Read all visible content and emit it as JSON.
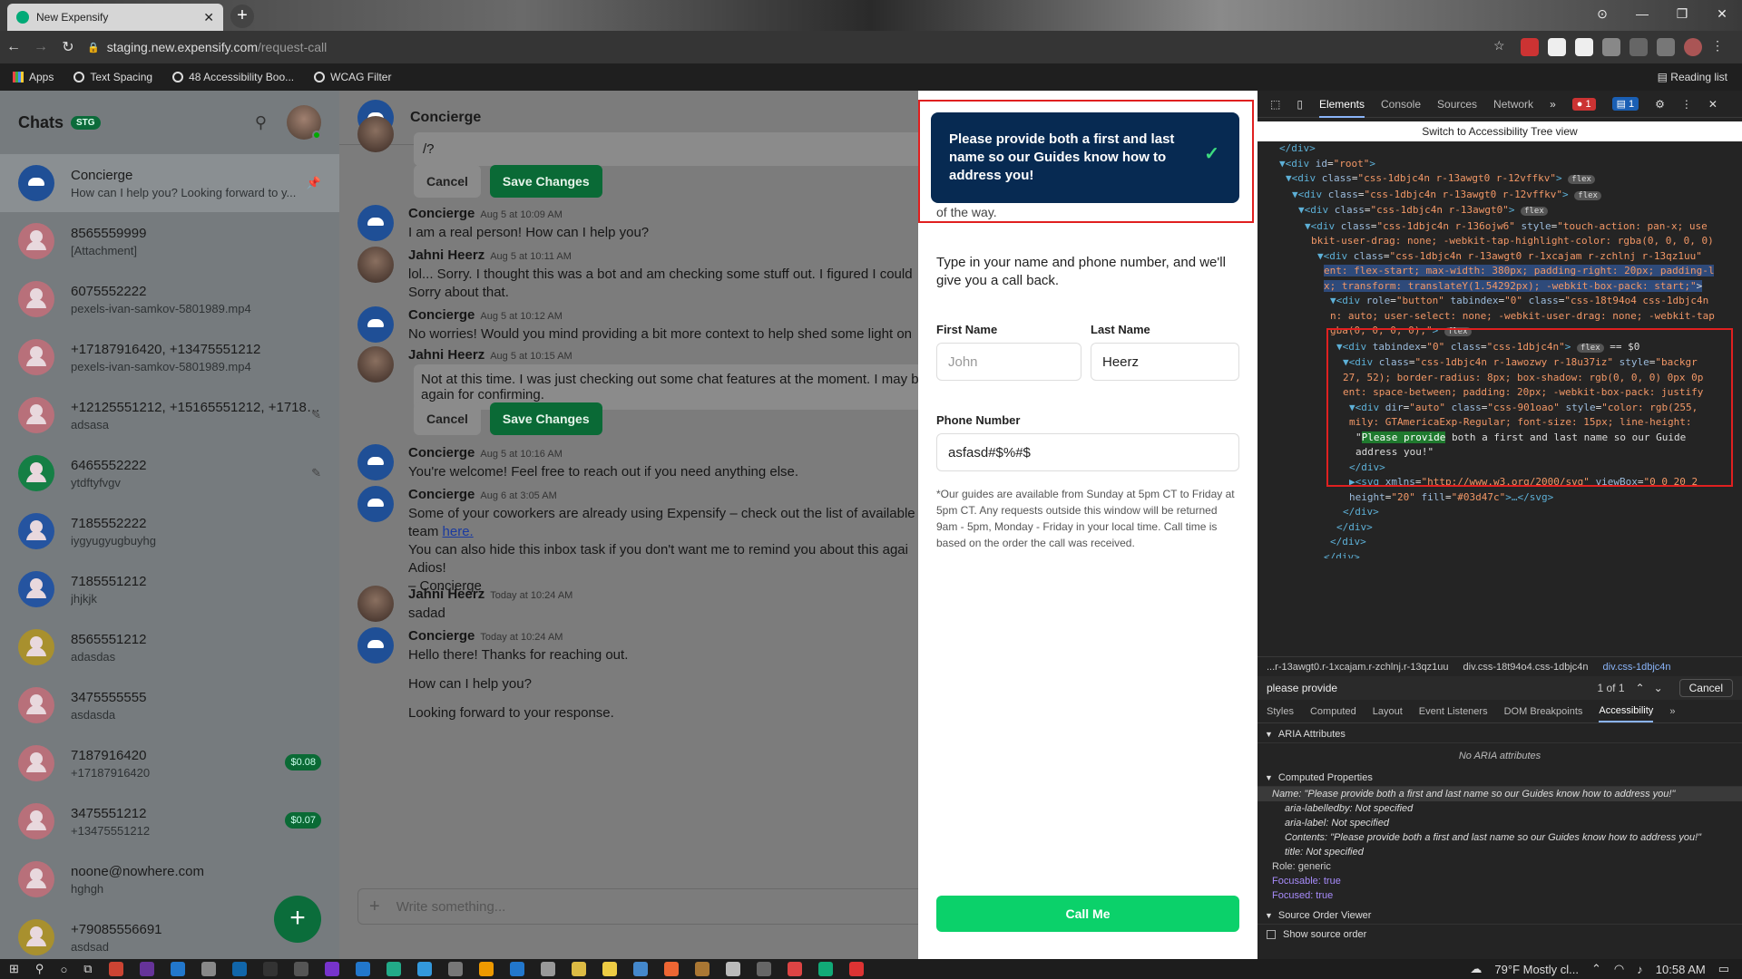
{
  "browser": {
    "tab_title": "New Expensify",
    "url_host": "staging.new.expensify.com",
    "url_path": "/request-call",
    "bookmarks": [
      "Apps",
      "Text Spacing",
      "48 Accessibility Boo...",
      "WCAG Filter"
    ],
    "reading_list": "Reading list"
  },
  "sidebar": {
    "title": "Chats",
    "badge": "STG",
    "chats": [
      {
        "name": "Concierge",
        "sub": "How can I help you? Looking forward to y...",
        "avatar": "concierge"
      },
      {
        "name": "8565559999",
        "sub": "[Attachment]",
        "avatar": "pink"
      },
      {
        "name": "6075552222",
        "sub": "pexels-ivan-samkov-5801989.mp4",
        "avatar": "pink"
      },
      {
        "name": "+17187916420, +13475551212",
        "sub": "pexels-ivan-samkov-5801989.mp4",
        "avatar": "pink"
      },
      {
        "name": "+12125551212, +15165551212, +17187...",
        "sub": "adsasa",
        "avatar": "pink"
      },
      {
        "name": "6465552222",
        "sub": "ytdftyfvgv",
        "avatar": "green"
      },
      {
        "name": "7185552222",
        "sub": "iygyugyugbuyhg",
        "avatar": "blue"
      },
      {
        "name": "7185551212",
        "sub": "jhjkjk",
        "avatar": "blue"
      },
      {
        "name": "8565551212",
        "sub": "adasdas",
        "avatar": "yellow"
      },
      {
        "name": "3475555555",
        "sub": "asdasda",
        "avatar": "pink"
      },
      {
        "name": "7187916420",
        "sub": "+17187916420",
        "avatar": "pink",
        "pill": "$0.08"
      },
      {
        "name": "3475551212",
        "sub": "+13475551212",
        "avatar": "pink",
        "pill": "$0.07"
      },
      {
        "name": "noone@nowhere.com",
        "sub": "hghgh",
        "avatar": "pink"
      },
      {
        "name": "+79085556691",
        "sub": "asdsad",
        "avatar": "yellow"
      }
    ]
  },
  "main": {
    "title": "Concierge",
    "edit1_text": "/?",
    "cancel": "Cancel",
    "save": "Save Changes",
    "messages": [
      {
        "who": "Concierge",
        "ts": "Aug 5 at 10:09 AM",
        "text": "I am a real person! How can I help you?"
      },
      {
        "who": "Jahni Heerz",
        "ts": "Aug 5 at 10:11 AM",
        "text": "lol... Sorry. I thought this was a bot and am checking some stuff out. I figured I could",
        "text2": "Sorry about that."
      },
      {
        "who": "Concierge",
        "ts": "Aug 5 at 10:12 AM",
        "text": "No worries! Would you mind providing a bit more context to help shed some light on"
      },
      {
        "who": "Jahni Heerz",
        "ts": "Aug 5 at 10:15 AM",
        "text": "Not at this time. I was just checking out some chat features at the moment. I may b",
        "text2": "again for confirming."
      },
      {
        "who": "Concierge",
        "ts": "Aug 5 at 10:16 AM",
        "text": "You're welcome! Feel free to reach out if you need anything else."
      },
      {
        "who": "Concierge",
        "ts": "Aug 6 at 3:05 AM",
        "text": "Some of your coworkers are already using Expensify – check out the list of available",
        "text2a": "team ",
        "link": "here.",
        "text3": "You can also hide this inbox task if you don't want me to remind you about this agai",
        "text4": "Adios!",
        "text5": "– Concierge"
      },
      {
        "who": "Jahni Heerz",
        "ts": "Today at 10:24 AM",
        "text": "sadad"
      },
      {
        "who": "Concierge",
        "ts": "Today at 10:24 AM",
        "text": "Hello there! Thanks for reaching out.",
        "text2": "How can I help you?",
        "text3": "Looking forward to your response."
      }
    ],
    "composer_placeholder": "Write something..."
  },
  "rhp": {
    "toast": "Please provide both a first and last name so our Guides know how to address you!",
    "frag": "of the way.",
    "intro": "Type in your name and phone number, and we'll give you a call back.",
    "first_label": "First Name",
    "first_placeholder": "John",
    "last_label": "Last Name",
    "last_value": "Heerz",
    "phone_label": "Phone Number",
    "phone_value": "asfasd#$%#$",
    "note": "*Our guides are available from Sunday at 5pm CT to Friday at 5pm CT. Any requests outside this window will be returned 9am - 5pm, Monday - Friday in your local time. Call time is based on the order the call was received.",
    "call_button": "Call Me"
  },
  "devtools": {
    "tabs": [
      "Elements",
      "Console",
      "Sources",
      "Network"
    ],
    "err_count": "1",
    "msg_count": "1",
    "switch": "Switch to Accessibility Tree view",
    "crumbs": [
      "...r-13awgt0.r-1xcajam.r-zchlnj.r-13qz1uu",
      "div.css-18t94o4.css-1dbjc4n",
      "div.css-1dbjc4n"
    ],
    "find_query": "please provide",
    "find_count": "1 of 1",
    "find_cancel": "Cancel",
    "subtabs": [
      "Styles",
      "Computed",
      "Layout",
      "Event Listeners",
      "DOM Breakpoints",
      "Accessibility"
    ],
    "aria_header": "ARIA Attributes",
    "aria_empty": "No ARIA attributes",
    "computed_header": "Computed Properties",
    "name_line": "Name: \"Please provide both a first and last name so our Guides know how to address you!\"",
    "labelledby": "aria-labelledby: Not specified",
    "arialabel": "aria-label: Not specified",
    "contents": "Contents: \"Please provide both a first and last name so our Guides know how to address you!\"",
    "title_line": "title: Not specified",
    "role": "Role: generic",
    "focusable": "Focusable: true",
    "focused": "Focused: true",
    "source_header": "Source Order Viewer",
    "show_source": "Show source order"
  },
  "taskbar": {
    "weather": "79°F  Mostly cl...",
    "time": "10:58 AM"
  }
}
